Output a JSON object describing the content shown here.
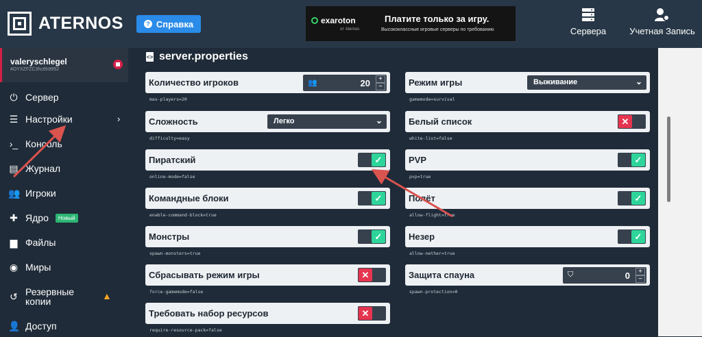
{
  "header": {
    "logo_text": "ATERNOS",
    "help_label": "Справка",
    "ad": {
      "brand": "exaroton",
      "brand_sub": "от Aternos",
      "title": "Платите только за игру.",
      "tagline": "Высококлассные игровые серверы по требованию"
    },
    "servers_label": "Сервера",
    "account_label": "Учетная Запись"
  },
  "sidebar": {
    "user": {
      "name": "valeryschlegel",
      "id": "#OYXZFZC3hc6h9952"
    },
    "items": [
      {
        "label": "Сервер",
        "icon": "power-icon"
      },
      {
        "label": "Настройки",
        "icon": "sliders-icon"
      },
      {
        "label": "Консоль",
        "icon": "terminal-icon"
      },
      {
        "label": "Журнал",
        "icon": "log-icon"
      },
      {
        "label": "Игроки",
        "icon": "users-icon"
      },
      {
        "label": "Ядро",
        "icon": "puzzle-icon",
        "badge": "Новый"
      },
      {
        "label": "Файлы",
        "icon": "folder-icon"
      },
      {
        "label": "Миры",
        "icon": "globe-icon"
      },
      {
        "label": "Резервные копии",
        "icon": "history-icon"
      },
      {
        "label": "Доступ",
        "icon": "user-lock-icon"
      }
    ]
  },
  "main": {
    "title": "server.properties",
    "left": [
      {
        "label": "Количество игроков",
        "key": "max-players=20",
        "kind": "stepper",
        "value": "20"
      },
      {
        "label": "Сложность",
        "key": "difficulty=easy",
        "kind": "select",
        "value": "Легко"
      },
      {
        "label": "Пиратский",
        "key": "online-mode=false",
        "kind": "toggle",
        "value": "on"
      },
      {
        "label": "Командные блоки",
        "key": "enable-command-block=true",
        "kind": "toggle",
        "value": "on"
      },
      {
        "label": "Монстры",
        "key": "spawn-monsters=true",
        "kind": "toggle",
        "value": "on"
      },
      {
        "label": "Сбрасывать режим игры",
        "key": "force-gamemode=false",
        "kind": "toggle",
        "value": "off"
      },
      {
        "label": "Требовать набор ресурсов",
        "key": "require-resource-pack=false",
        "kind": "toggle",
        "value": "off"
      }
    ],
    "right": [
      {
        "label": "Режим игры",
        "key": "gamemode=survival",
        "kind": "select",
        "value": "Выживание"
      },
      {
        "label": "Белый список",
        "key": "white-list=false",
        "kind": "toggle",
        "value": "off"
      },
      {
        "label": "PVP",
        "key": "pvp=true",
        "kind": "toggle",
        "value": "on"
      },
      {
        "label": "Полёт",
        "key": "allow-flight=true",
        "kind": "toggle",
        "value": "on"
      },
      {
        "label": "Незер",
        "key": "allow-nether=true",
        "kind": "toggle",
        "value": "on"
      },
      {
        "label": "Защита спауна",
        "key": "spawn-protection=0",
        "kind": "stepper",
        "value": "0"
      }
    ]
  },
  "colors": {
    "accent_on": "#2ed59a",
    "accent_off": "#e6354f",
    "annotation_arrow": "#d9534f"
  }
}
